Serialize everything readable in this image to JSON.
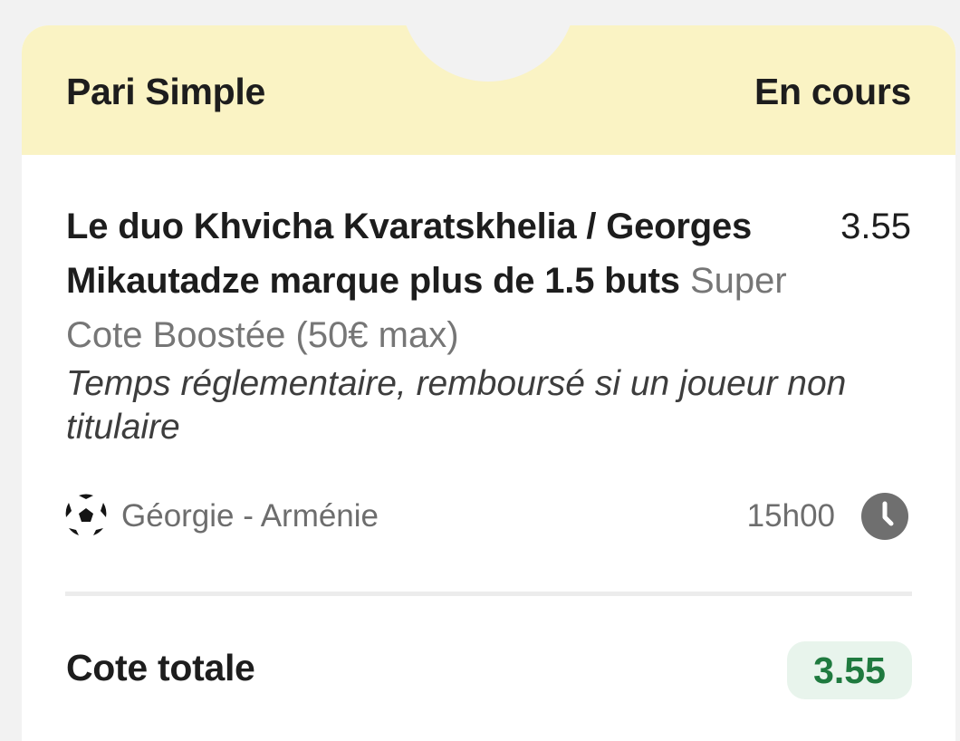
{
  "header": {
    "bet_type": "Pari Simple",
    "status": "En cours"
  },
  "selection": {
    "name": "Le duo Khvicha Kvaratskhelia / Georges Mikautadze marque plus de 1.5 buts",
    "boost_label": "Super Cote Boostée (50€ max)",
    "odds": "3.55",
    "note": "Temps réglementaire, remboursé si un joueur non titulaire"
  },
  "event": {
    "sport_icon": "soccer-ball-icon",
    "match": "Géorgie - Arménie",
    "time": "15h00",
    "time_icon": "clock-icon"
  },
  "total": {
    "label": "Cote totale",
    "value": "3.55"
  },
  "colors": {
    "header_background": "#faf3c4",
    "card_background": "#ffffff",
    "page_background": "#f2f2f2",
    "total_badge_background": "#e8f4ec",
    "total_badge_text": "#1f7a3f",
    "clock_icon": "#6f6f6f"
  }
}
